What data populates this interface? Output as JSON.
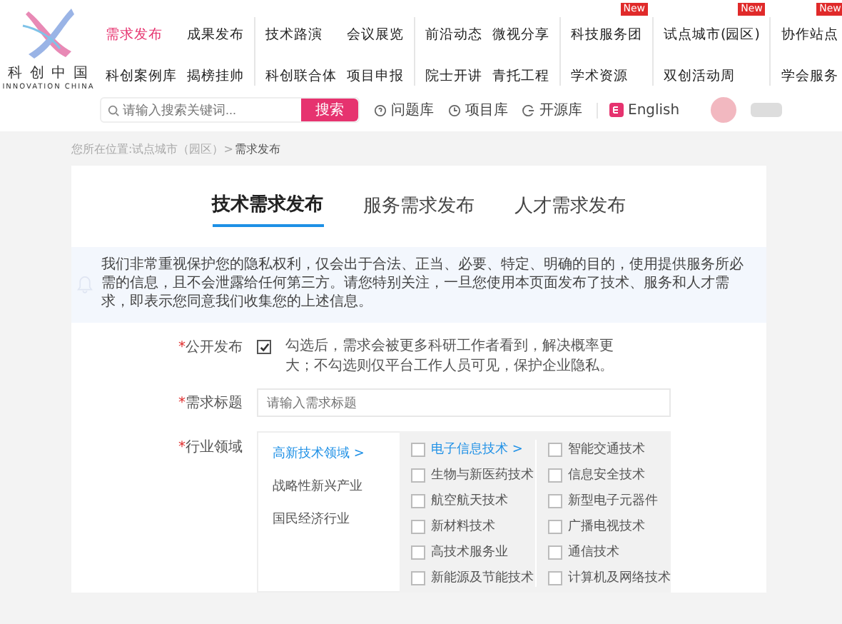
{
  "logo": {
    "name": "科 创 中 国",
    "tagline": "INNOVATION CHINA"
  },
  "nav_groups": [
    {
      "items": [
        {
          "label": "需求发布",
          "selected": true
        },
        {
          "label": "成果发布",
          "selected": false
        },
        {
          "label": "科创案例库",
          "selected": false
        },
        {
          "label": "揭榜挂帅",
          "selected": false
        }
      ]
    },
    {
      "items": [
        {
          "label": "技术路演",
          "selected": false
        },
        {
          "label": "会议展览",
          "selected": false
        },
        {
          "label": "科创联合体",
          "selected": false
        },
        {
          "label": "项目申报",
          "selected": false
        }
      ]
    },
    {
      "items": [
        {
          "label": "前沿动态",
          "selected": false
        },
        {
          "label": "微视分享",
          "selected": false
        },
        {
          "label": "院士开讲",
          "selected": false
        },
        {
          "label": "青托工程",
          "selected": false
        }
      ]
    },
    {
      "items": [
        {
          "label": "科技服务团",
          "selected": false,
          "badge": "New"
        },
        {
          "label": "学术资源",
          "selected": false
        }
      ]
    },
    {
      "items": [
        {
          "label": "试点城市(园区)",
          "selected": false,
          "badge": "New"
        },
        {
          "label": "双创活动周",
          "selected": false
        }
      ]
    },
    {
      "items": [
        {
          "label": "协作站点",
          "selected": false,
          "badge": "New"
        },
        {
          "label": "学会服务",
          "selected": false
        }
      ]
    }
  ],
  "search": {
    "placeholder": "请输入搜索关键词...",
    "button": "搜索"
  },
  "quick_links": [
    {
      "kind": "question",
      "label": "问题库"
    },
    {
      "kind": "clock",
      "label": "项目库"
    },
    {
      "kind": "open",
      "label": "开源库"
    }
  ],
  "language": "English",
  "breadcrumb": {
    "path": "您所在位置:试点城市（园区）>",
    "current": "需求发布"
  },
  "tabs": [
    {
      "label": "技术需求发布",
      "selected": true
    },
    {
      "label": "服务需求发布",
      "selected": false
    },
    {
      "label": "人才需求发布",
      "selected": false
    }
  ],
  "notice": "我们非常重视保护您的隐私权利，仅会出于合法、正当、必要、特定、明确的目的，使用提供服务所必需的信息，且不会泄露给任何第三方。请您特别关注，一旦您使用本页面发布了技术、服务和人才需求，即表示您同意我们收集您的上述信息。",
  "public_field": {
    "mark": "*",
    "label": "公开发布",
    "checked": true,
    "text": "勾选后，需求会被更多科研工作者看到，解决概率更大；不勾选则仅平台工作人员可见，保护企业隐私。"
  },
  "title_field": {
    "mark": "*",
    "label": "需求标题",
    "placeholder": "请输入需求标题"
  },
  "industry_field": {
    "mark": "*",
    "label": "行业领域",
    "categories": [
      {
        "label": "高新技术领域 >",
        "selected": true
      },
      {
        "label": "战略性新兴产业",
        "selected": false
      },
      {
        "label": "国民经济行业",
        "selected": false
      }
    ],
    "option_columns": [
      [
        {
          "label": "电子信息技术 >",
          "selected": true,
          "checked": false
        },
        {
          "label": "生物与新医药技术",
          "selected": false,
          "checked": false
        },
        {
          "label": "航空航天技术",
          "selected": false,
          "checked": false
        },
        {
          "label": "新材料技术",
          "selected": false,
          "checked": false
        },
        {
          "label": "高技术服务业",
          "selected": false,
          "checked": false
        },
        {
          "label": "新能源及节能技术",
          "selected": false,
          "checked": false
        }
      ],
      [
        {
          "label": "智能交通技术",
          "selected": false,
          "checked": false
        },
        {
          "label": "信息安全技术",
          "selected": false,
          "checked": false
        },
        {
          "label": "新型电子元器件",
          "selected": false,
          "checked": false
        },
        {
          "label": "广播电视技术",
          "selected": false,
          "checked": false
        },
        {
          "label": "通信技术",
          "selected": false,
          "checked": false
        },
        {
          "label": "计算机及网络技术",
          "selected": false,
          "checked": false
        }
      ]
    ]
  }
}
